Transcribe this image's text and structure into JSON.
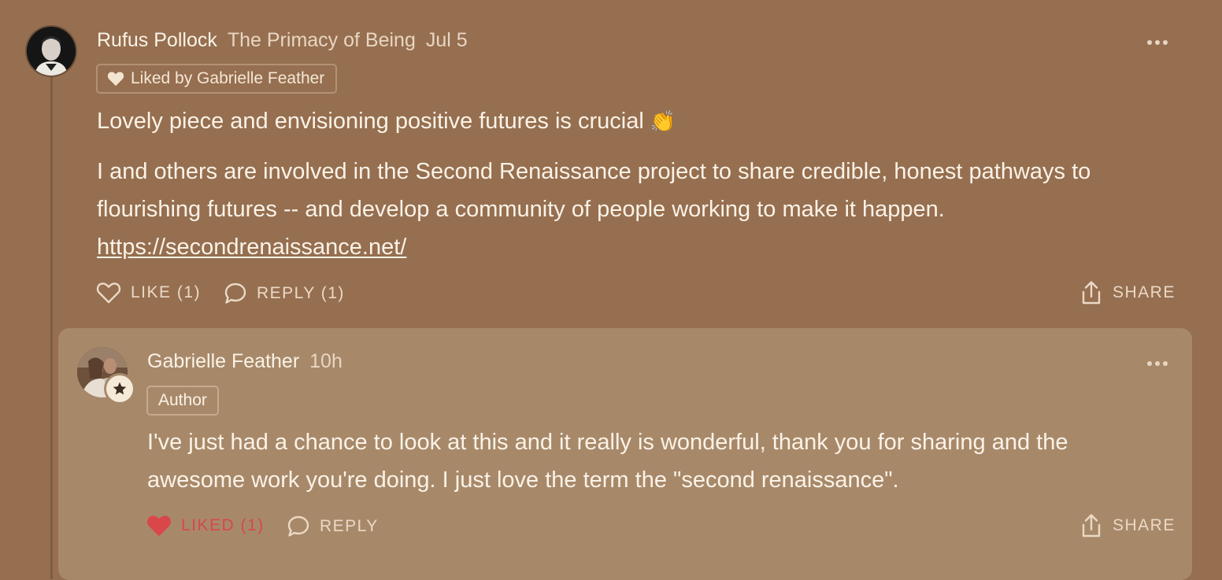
{
  "comment": {
    "author": "Rufus Pollock",
    "publication": "The Primacy of Being",
    "date": "Jul 5",
    "liked_badge": "Liked by Gabrielle Feather",
    "paragraph1": "Lovely piece and envisioning positive futures is crucial",
    "paragraph1_emoji": "👏",
    "paragraph2": "I and others are involved in the Second Renaissance project to share credible, honest pathways to flourishing futures -- and develop a community of people working to make it happen.",
    "link": "https://secondrenaissance.net/",
    "actions": {
      "like": "LIKE (1)",
      "reply": "REPLY (1)",
      "share": "SHARE"
    }
  },
  "reply": {
    "author": "Gabrielle Feather",
    "time": "10h",
    "badge": "Author",
    "text": "I've just had a chance to look at this and it really is wonderful, thank you for sharing and the awesome work you're doing. I just love the term the \"second renaissance\".",
    "actions": {
      "liked": "LIKED (1)",
      "reply": "REPLY",
      "share": "SHARE"
    }
  },
  "colors": {
    "background": "#956f50",
    "reply_background": "#a7896a",
    "liked_red": "#d9474a"
  }
}
